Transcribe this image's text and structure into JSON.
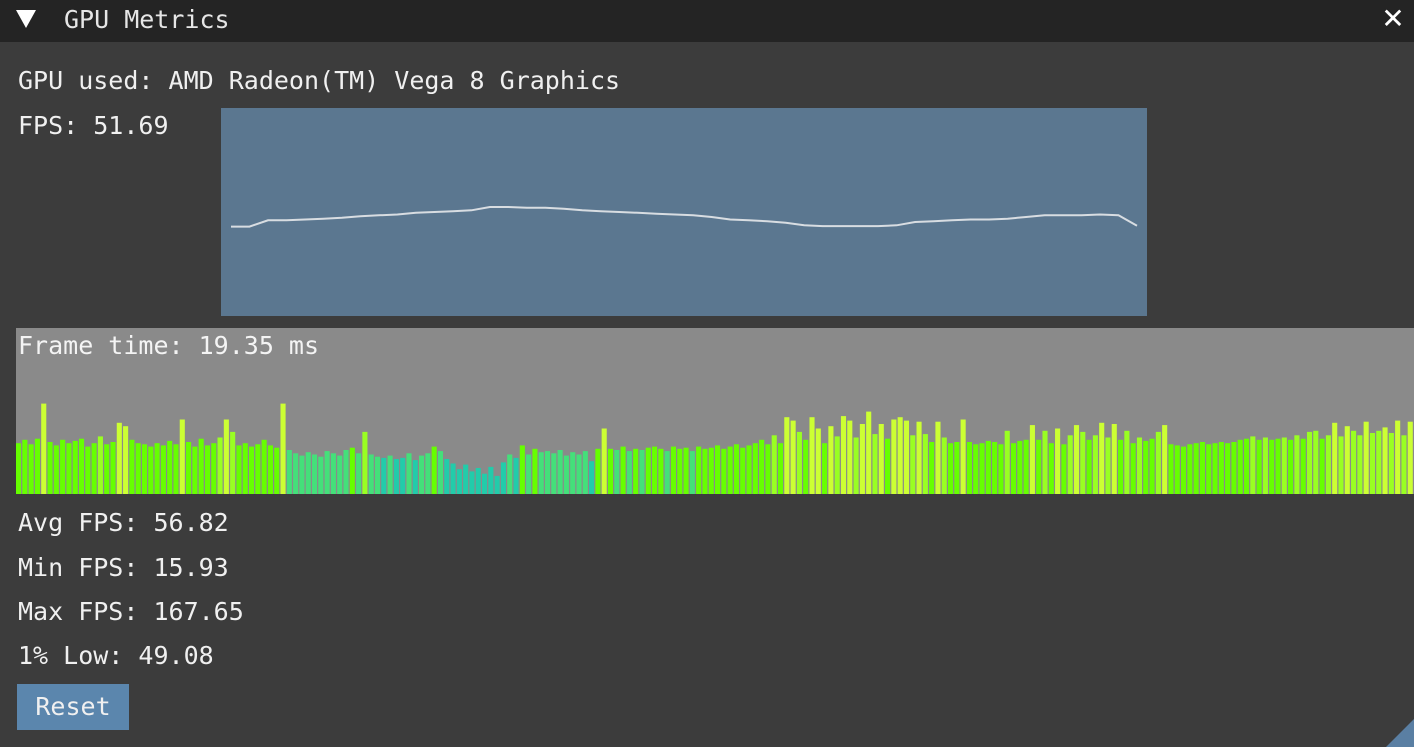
{
  "window": {
    "title": "GPU Metrics",
    "close_icon": "close-icon",
    "collapse_icon": "triangle-down-icon"
  },
  "gpu": {
    "text": "GPU used: AMD Radeon(TM) Vega 8 Graphics"
  },
  "fps": {
    "text": "FPS: 51.69"
  },
  "frame_time": {
    "text": "Frame time: 19.35 ms"
  },
  "stats": {
    "avg": "Avg FPS: 56.82",
    "min": "Min FPS: 15.93",
    "max": "Max FPS: 167.65",
    "low": "1% Low: 49.08"
  },
  "reset_label": "Reset",
  "colors": {
    "plot_bg": "#5b7790",
    "histogram_bg": "#8a8a8a",
    "button": "#5b86ad",
    "bar_green": "#66ff00",
    "bar_yellow": "#ccff33",
    "bar_teal": "#22ccaa"
  },
  "chart_data": [
    {
      "type": "line",
      "description_source": "fps-plot",
      "values": [
        51.5,
        51.5,
        53.0,
        53.0,
        53.2,
        53.4,
        53.6,
        54.0,
        54.2,
        54.4,
        54.8,
        55.0,
        55.2,
        55.4,
        56.2,
        56.2,
        56.0,
        56.0,
        55.8,
        55.4,
        55.2,
        55.0,
        54.8,
        54.6,
        54.4,
        54.2,
        53.8,
        53.2,
        53.0,
        52.8,
        52.4,
        51.8,
        51.6,
        51.6,
        51.6,
        51.6,
        51.8,
        52.6,
        52.8,
        53.0,
        53.2,
        53.2,
        53.4,
        53.8,
        54.2,
        54.2,
        54.2,
        54.4,
        54.2,
        51.7
      ],
      "ylim": [
        30,
        80
      ]
    },
    {
      "type": "bar",
      "description_source": "frame-time-histogram",
      "values": [
        16.5,
        16.8,
        16.4,
        16.9,
        20.0,
        16.6,
        16.3,
        16.8,
        16.5,
        16.7,
        16.9,
        16.2,
        16.5,
        17.1,
        16.4,
        16.6,
        18.3,
        18.0,
        16.8,
        16.5,
        16.4,
        16.2,
        16.5,
        16.3,
        16.7,
        16.4,
        18.6,
        16.6,
        16.2,
        16.9,
        16.3,
        16.5,
        17.0,
        18.6,
        17.5,
        16.3,
        16.5,
        16.2,
        16.4,
        16.8,
        16.3,
        16.1,
        20.0,
        15.9,
        15.6,
        15.4,
        15.7,
        15.5,
        15.3,
        15.8,
        15.6,
        15.4,
        15.9,
        16.1,
        15.6,
        17.5,
        15.5,
        15.3,
        15.2,
        15.4,
        15.1,
        15.2,
        15.6,
        15.0,
        15.4,
        15.6,
        16.2,
        15.8,
        15.1,
        14.7,
        14.2,
        14.6,
        14.0,
        14.3,
        13.8,
        14.4,
        13.6,
        14.8,
        15.5,
        15.2,
        16.3,
        15.5,
        16.0,
        15.7,
        15.8,
        15.6,
        15.9,
        15.4,
        15.7,
        15.5,
        15.8,
        14.9,
        16.0,
        17.8,
        16.0,
        15.9,
        16.2,
        15.8,
        16.0,
        15.9,
        16.1,
        16.2,
        16.0,
        15.8,
        16.2,
        16.0,
        16.1,
        15.8,
        16.2,
        16.0,
        16.1,
        16.3,
        16.0,
        16.2,
        16.4,
        16.1,
        16.3,
        16.5,
        16.8,
        16.4,
        17.2,
        16.5,
        18.8,
        18.5,
        17.5,
        16.8,
        18.8,
        17.8,
        16.5,
        18.0,
        17.1,
        18.9,
        18.5,
        17.0,
        18.2,
        19.3,
        17.3,
        18.2,
        16.9,
        18.6,
        18.8,
        18.5,
        17.2,
        18.4,
        17.3,
        16.6,
        18.4,
        17.0,
        16.5,
        16.6,
        18.6,
        16.6,
        16.4,
        16.5,
        16.7,
        16.6,
        16.4,
        17.6,
        16.5,
        16.7,
        16.8,
        18.1,
        16.8,
        17.6,
        16.5,
        17.8,
        16.4,
        17.2,
        18.1,
        17.5,
        16.8,
        17.2,
        18.3,
        17.0,
        18.2,
        16.8,
        17.6,
        16.5,
        17.0,
        16.7,
        16.9,
        17.5,
        18.1,
        16.4,
        16.3,
        16.2,
        16.4,
        16.5,
        16.6,
        16.4,
        16.5,
        16.6,
        16.5,
        16.6,
        16.8,
        16.9,
        17.1,
        16.8,
        17.0,
        16.8,
        16.9,
        17.0,
        16.8,
        17.2,
        16.9,
        17.5,
        17.6,
        16.9,
        17.2,
        18.3,
        17.1,
        18.0,
        17.6,
        17.2,
        18.4,
        17.4,
        17.6,
        17.9,
        17.4,
        18.5,
        17.2,
        18.4
      ]
    }
  ]
}
